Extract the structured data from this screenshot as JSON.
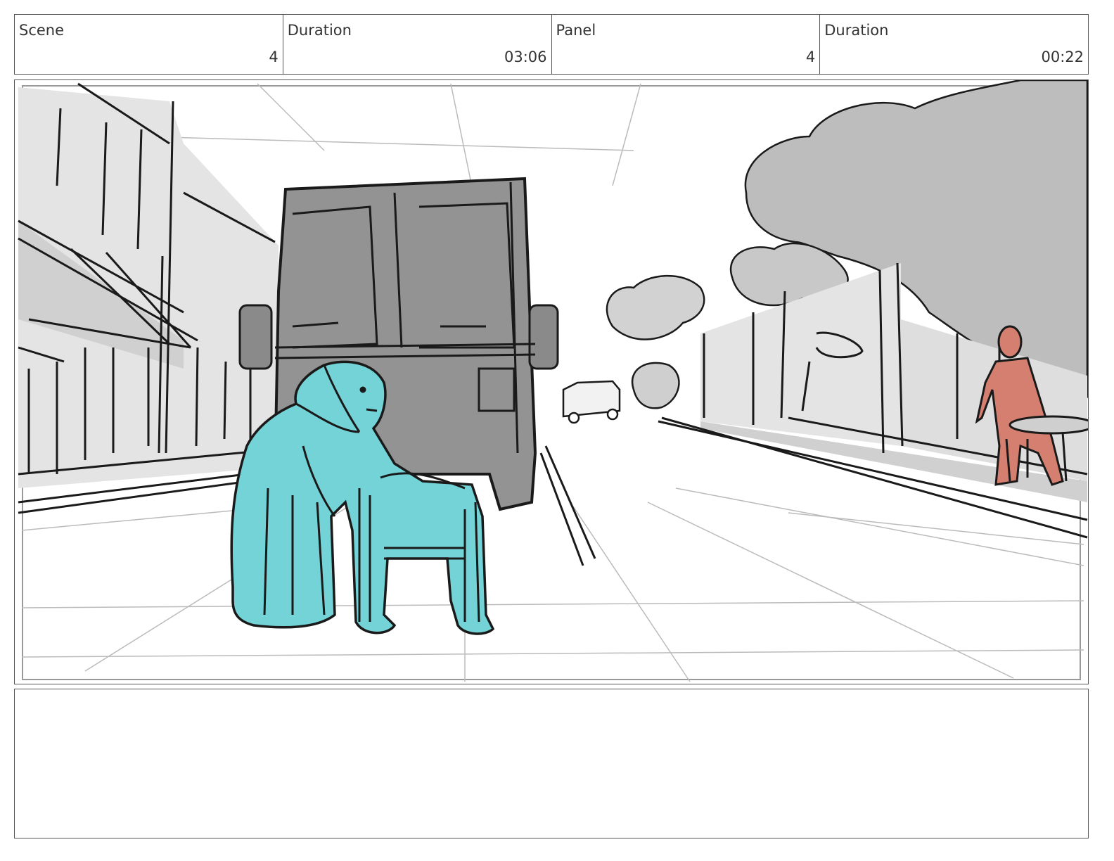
{
  "header": {
    "scene_label": "Scene",
    "scene_value": "4",
    "scene_duration_label": "Duration",
    "scene_duration_value": "03:06",
    "panel_label": "Panel",
    "panel_value": "4",
    "panel_duration_label": "Duration",
    "panel_duration_value": "00:22"
  },
  "colors": {
    "woman_fill": "#74d3d6",
    "man_fill": "#d47f70",
    "truck_fill": "#939393",
    "tree_fill": "#bdbdbd",
    "building_fill": "#e4e4e4"
  },
  "notes": {
    "text": ""
  }
}
